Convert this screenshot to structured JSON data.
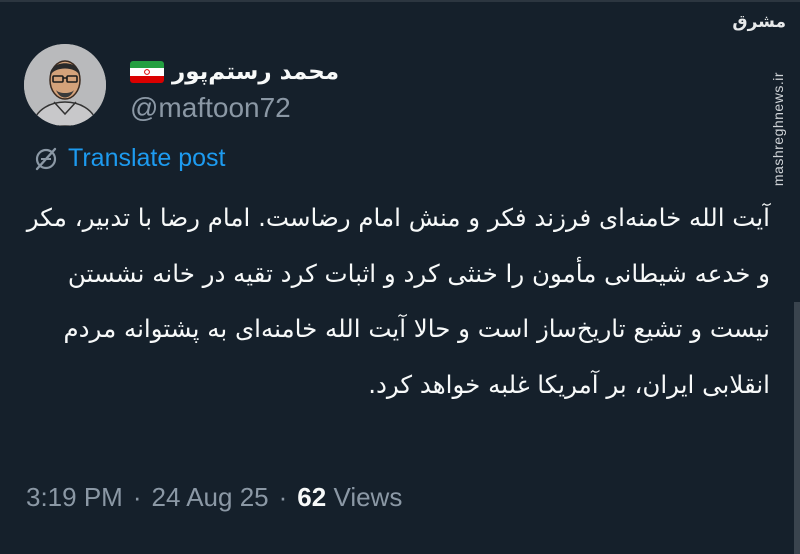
{
  "author": {
    "display_name": "محمد رستم‌پور",
    "handle": "@maftoon72",
    "flag_colors": [
      "#239f40",
      "#ffffff",
      "#da0000"
    ]
  },
  "translate": {
    "label": "Translate post",
    "icon": "globe-off-icon"
  },
  "tweet": {
    "text": "آیت الله خامنه‌ای فرزند فکر و منش امام رضاست. امام رضا با تدبیر، مکر و خدعه شیطانی مأمون را خنثی کرد و اثبات کرد تقیه در خانه نشستن نیست و تشیع تاریخ‌ساز است و حالا آیت الله خامنه‌ای به پشتوانه مردم انقلابی ایران، بر آمریکا غلبه خواهد کرد."
  },
  "meta": {
    "time": "3:19 PM",
    "date": "24 Aug 25",
    "views_count": "62",
    "views_label": "Views",
    "separator": "·"
  },
  "watermark": {
    "logo_text": "مشرق",
    "url": "mashreghnews.ir"
  },
  "colors": {
    "background": "#15202b",
    "text": "#f7f9f9",
    "muted": "#8b98a5",
    "accent": "#1d9bf0"
  }
}
